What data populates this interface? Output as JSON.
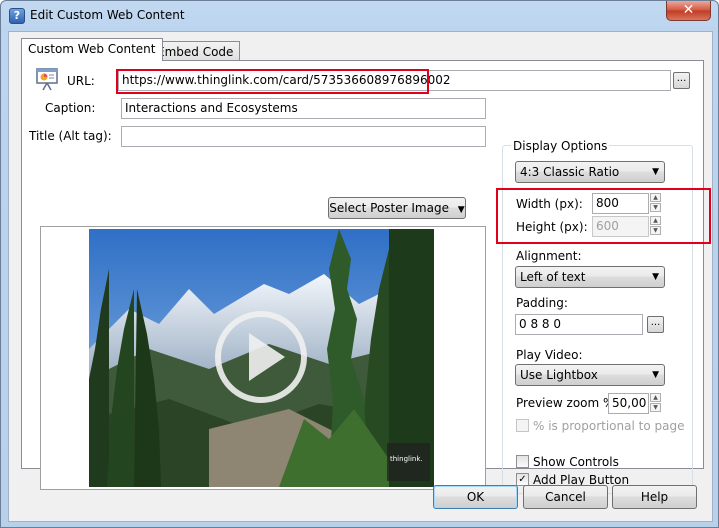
{
  "window": {
    "title": "Edit Custom Web Content",
    "close_glyph": "✕"
  },
  "tabs": [
    {
      "label": "Custom Web Content"
    },
    {
      "label": "Embed Code"
    }
  ],
  "form": {
    "url_label": "URL:",
    "url_value": "https://www.thinglink.com/card/573536608976896002",
    "caption_label": "Caption:",
    "caption_value": "Interactions and Ecosystems",
    "title_label": "Title (Alt tag):",
    "title_value": "",
    "dots": "..."
  },
  "poster": {
    "button_label": "Select Poster Image",
    "watermark_text": "thinglink."
  },
  "display_options": {
    "group_label": "Display Options",
    "ratio_value": "4:3 Classic Ratio",
    "width_label": "Width (px):",
    "width_value": "800",
    "height_label": "Height (px):",
    "height_value": "600",
    "alignment_label": "Alignment:",
    "alignment_value": "Left of text",
    "padding_label": "Padding:",
    "padding_value": "0 8 8 0",
    "play_video_label": "Play Video:",
    "play_video_value": "Use Lightbox",
    "preview_zoom_label": "Preview zoom %:",
    "preview_zoom_value": "50,00",
    "proportional_label": "% is proportional to page",
    "proportional_checked": false,
    "show_controls_label": "Show Controls",
    "show_controls_checked": false,
    "add_play_label": "Add Play Button",
    "add_play_checked": true
  },
  "footer": {
    "ok_label": "OK",
    "cancel_label": "Cancel",
    "help_label": "Help"
  },
  "icons": {
    "app": "question-icon",
    "url_type": "presentation-board-icon",
    "dropdown": "triangle-down-icon",
    "check": "✓"
  },
  "colors": {
    "highlight": "#e0001b",
    "titlebar": "#c2d9f1",
    "close": "#c13b23"
  }
}
